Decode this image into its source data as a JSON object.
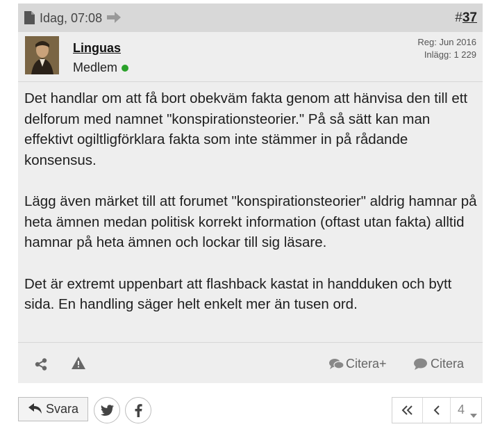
{
  "post": {
    "date": "Idag, 07:08",
    "number_prefix": "#",
    "number": "37",
    "user": {
      "name": "Linguas",
      "title": "Medlem",
      "online_status_color": "#2aa12a",
      "reg": "Reg: Jun 2016",
      "posts": "Inlägg: 1 229"
    },
    "paragraphs": [
      "Det handlar om att få bort obekväm fakta genom att hänvisa den till ett delforum med namnet \"konspirationsteorier.\" På så sätt kan man effektivt ogiltligförklara fakta som inte stämmer in på rådande konsensus.",
      "Lägg även märket till att forumet \"konspirationsteorier\" aldrig hamnar på heta ämnen medan politisk korrekt information (oftast utan fakta) alltid hamnar på heta ämnen och lockar till sig läsare.",
      "Det är extremt uppenbart att flashback kastat in handduken och bytt sida. En handling säger helt enkelt mer än tusen ord."
    ],
    "footer": {
      "share_icon": "share-icon",
      "report_icon": "warning-icon",
      "multiquote_label": "Citera+",
      "quote_label": "Citera"
    }
  },
  "actions": {
    "reply_label": "Svara",
    "twitter_icon": "twitter-icon",
    "facebook_icon": "facebook-icon"
  },
  "pagination": {
    "current_page": "4"
  }
}
